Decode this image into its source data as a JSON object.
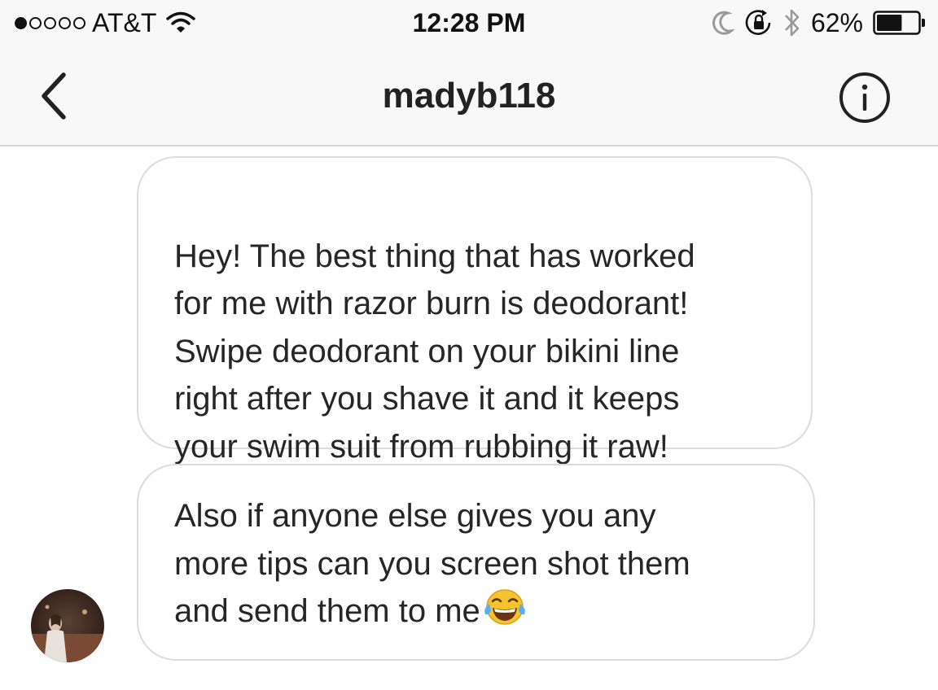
{
  "status_bar": {
    "signal_strength": 1,
    "signal_max": 5,
    "carrier": "AT&T",
    "time": "12:28 PM",
    "battery_percent": "62%",
    "battery_level": 0.62,
    "icons": [
      "wifi-icon",
      "moon-icon",
      "rotation-lock-icon",
      "bluetooth-icon",
      "battery-icon"
    ]
  },
  "nav": {
    "title": "madyb118",
    "back_icon": "chevron-left-icon",
    "info_icon": "info-icon"
  },
  "messages": [
    {
      "text": "Hey! The best thing that has worked\nfor me with razor burn is deodorant!\nSwipe deodorant on your bikini line\nright after you shave it and it keeps\nyour swim suit from rubbing it raw!"
    },
    {
      "text": "Also if anyone else gives you any\nmore tips can you screen shot them\nand send them to me",
      "trailing_emoji": "face-with-tears-of-joy-emoji"
    }
  ],
  "colors": {
    "bar_background": "#f8f8f8",
    "bubble_border": "#dcdcdc",
    "text": "#262626"
  }
}
